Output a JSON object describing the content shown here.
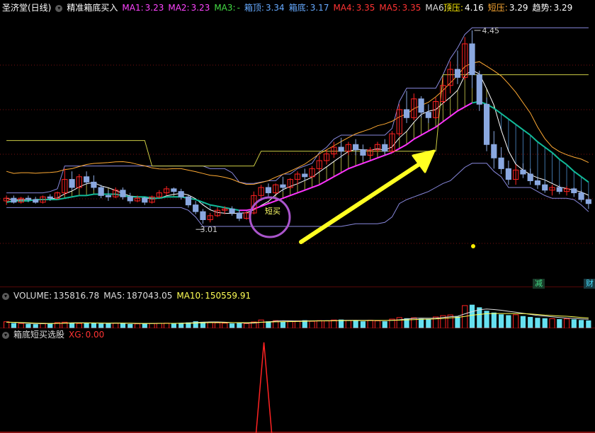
{
  "header": {
    "title": "圣济堂(日线)",
    "indicator_name": "精准箱底买入",
    "items": [
      {
        "label": "MA1:",
        "value": "3.23",
        "color": "#ff44ff"
      },
      {
        "label": "MA2:",
        "value": "3.23",
        "color": "#ff44ff"
      },
      {
        "label": "MA3:",
        "value": "-",
        "color": "#44dd44"
      },
      {
        "label": "箱顶:",
        "value": "3.34",
        "color": "#66aaff"
      },
      {
        "label": "箱底:",
        "value": "3.17",
        "color": "#66aaff"
      },
      {
        "label": "MA4:",
        "value": "3.35",
        "color": "#ff3333"
      },
      {
        "label": "MA5:",
        "value": "3.35",
        "color": "#ff3333"
      },
      {
        "label": "MA6:",
        "value": "-",
        "color": "#dddddd"
      }
    ],
    "right_items": [
      {
        "label": "顶压:",
        "value": "4.16",
        "color": "#ffee00"
      },
      {
        "label": "短压:",
        "value": "3.29",
        "color": "#ffaa33"
      },
      {
        "label": "趋势:",
        "value": "3.29",
        "color": "#ffffff"
      }
    ]
  },
  "annotations": {
    "high_label": "4.45",
    "low_label": "3.01",
    "buy_label": "短买",
    "tag_reduce": "减",
    "tag_wealth": "财"
  },
  "volume_header": {
    "volume": {
      "label": "VOLUME:",
      "value": "135816.78"
    },
    "ma5": {
      "label": "MA5:",
      "value": "187043.05"
    },
    "ma10": {
      "label": "MA10:",
      "value": "150559.91"
    }
  },
  "xg_header": {
    "name": "箱底短买选股",
    "xg": {
      "label": "XG:",
      "value": "0.00"
    }
  },
  "colors": {
    "up": "#ff2222",
    "down": "#8aa8e0",
    "ma_pink": "#ff33ff",
    "ma_teal": "#11bb99",
    "ma_yellow": "#ffff88",
    "box_blue": "#8888dd",
    "orange": "#ffaa33",
    "arrow": "#ffff22",
    "circle": "#aa55cc"
  },
  "chart_data": [
    {
      "type": "candlestick",
      "title": "",
      "ylim": [
        2.6,
        4.55
      ],
      "annotations": {
        "high": 4.45,
        "low": 3.01
      },
      "candles": [
        [
          3.18,
          3.22,
          3.15,
          3.2
        ],
        [
          3.2,
          3.22,
          3.16,
          3.17
        ],
        [
          3.17,
          3.21,
          3.16,
          3.2
        ],
        [
          3.2,
          3.22,
          3.17,
          3.19
        ],
        [
          3.19,
          3.21,
          3.16,
          3.17
        ],
        [
          3.17,
          3.22,
          3.16,
          3.21
        ],
        [
          3.21,
          3.23,
          3.18,
          3.2
        ],
        [
          3.2,
          3.25,
          3.19,
          3.24
        ],
        [
          3.24,
          3.42,
          3.22,
          3.34
        ],
        [
          3.34,
          3.4,
          3.26,
          3.28
        ],
        [
          3.28,
          3.38,
          3.27,
          3.36
        ],
        [
          3.36,
          3.4,
          3.3,
          3.32
        ],
        [
          3.32,
          3.37,
          3.26,
          3.28
        ],
        [
          3.28,
          3.3,
          3.2,
          3.22
        ],
        [
          3.22,
          3.26,
          3.18,
          3.21
        ],
        [
          3.21,
          3.28,
          3.2,
          3.26
        ],
        [
          3.26,
          3.28,
          3.19,
          3.21
        ],
        [
          3.21,
          3.24,
          3.16,
          3.18
        ],
        [
          3.18,
          3.22,
          3.17,
          3.2
        ],
        [
          3.2,
          3.21,
          3.15,
          3.17
        ],
        [
          3.17,
          3.22,
          3.16,
          3.21
        ],
        [
          3.21,
          3.26,
          3.2,
          3.24
        ],
        [
          3.24,
          3.29,
          3.22,
          3.27
        ],
        [
          3.27,
          3.28,
          3.23,
          3.25
        ],
        [
          3.25,
          3.27,
          3.19,
          3.21
        ],
        [
          3.21,
          3.22,
          3.13,
          3.15
        ],
        [
          3.15,
          3.18,
          3.08,
          3.1
        ],
        [
          3.1,
          3.12,
          3.01,
          3.04
        ],
        [
          3.04,
          3.09,
          3.02,
          3.07
        ],
        [
          3.07,
          3.13,
          3.06,
          3.11
        ],
        [
          3.11,
          3.14,
          3.08,
          3.12
        ],
        [
          3.12,
          3.14,
          3.07,
          3.09
        ],
        [
          3.09,
          3.11,
          3.03,
          3.05
        ],
        [
          3.05,
          3.1,
          3.04,
          3.09
        ],
        [
          3.09,
          3.25,
          3.08,
          3.22
        ],
        [
          3.22,
          3.3,
          3.18,
          3.28
        ],
        [
          3.28,
          3.31,
          3.21,
          3.24
        ],
        [
          3.24,
          3.31,
          3.23,
          3.3
        ],
        [
          3.3,
          3.36,
          3.25,
          3.28
        ],
        [
          3.28,
          3.35,
          3.27,
          3.34
        ],
        [
          3.34,
          3.4,
          3.3,
          3.38
        ],
        [
          3.38,
          3.42,
          3.33,
          3.36
        ],
        [
          3.36,
          3.44,
          3.35,
          3.42
        ],
        [
          3.42,
          3.52,
          3.4,
          3.48
        ],
        [
          3.48,
          3.56,
          3.45,
          3.53
        ],
        [
          3.53,
          3.62,
          3.5,
          3.58
        ],
        [
          3.58,
          3.65,
          3.5,
          3.55
        ],
        [
          3.55,
          3.62,
          3.52,
          3.6
        ],
        [
          3.6,
          3.64,
          3.52,
          3.56
        ],
        [
          3.56,
          3.6,
          3.48,
          3.52
        ],
        [
          3.52,
          3.58,
          3.5,
          3.56
        ],
        [
          3.56,
          3.62,
          3.54,
          3.6
        ],
        [
          3.6,
          3.64,
          3.52,
          3.55
        ],
        [
          3.55,
          3.7,
          3.54,
          3.68
        ],
        [
          3.68,
          3.9,
          3.66,
          3.86
        ],
        [
          3.86,
          4.0,
          3.76,
          3.8
        ],
        [
          3.8,
          3.98,
          3.78,
          3.94
        ],
        [
          3.94,
          3.96,
          3.8,
          3.84
        ],
        [
          3.84,
          3.9,
          3.76,
          3.8
        ],
        [
          3.8,
          3.95,
          3.79,
          3.92
        ],
        [
          3.92,
          4.1,
          3.9,
          4.04
        ],
        [
          4.04,
          4.22,
          3.98,
          4.16
        ],
        [
          4.16,
          4.3,
          4.05,
          4.1
        ],
        [
          4.1,
          4.4,
          4.08,
          4.35
        ],
        [
          4.35,
          4.45,
          4.02,
          4.12
        ],
        [
          4.12,
          4.15,
          3.85,
          3.9
        ],
        [
          3.9,
          3.95,
          3.55,
          3.6
        ],
        [
          3.6,
          3.7,
          3.42,
          3.5
        ],
        [
          3.5,
          3.58,
          3.38,
          3.42
        ],
        [
          3.42,
          3.48,
          3.3,
          3.34
        ],
        [
          3.34,
          3.45,
          3.3,
          3.41
        ],
        [
          3.41,
          3.46,
          3.35,
          3.38
        ],
        [
          3.38,
          3.42,
          3.3,
          3.33
        ],
        [
          3.33,
          3.36,
          3.27,
          3.3
        ],
        [
          3.3,
          3.34,
          3.24,
          3.26
        ],
        [
          3.26,
          3.3,
          3.22,
          3.28
        ],
        [
          3.28,
          3.3,
          3.23,
          3.25
        ],
        [
          3.25,
          3.29,
          3.22,
          3.27
        ],
        [
          3.27,
          3.28,
          3.21,
          3.24
        ],
        [
          3.24,
          3.26,
          3.17,
          3.19
        ],
        [
          3.19,
          3.22,
          3.12,
          3.16
        ]
      ],
      "series": [
        {
          "values": [
            3.17,
            3.18,
            3.18,
            3.18,
            3.19,
            3.19,
            3.19,
            3.19,
            3.2,
            3.21,
            3.22,
            3.22,
            3.23,
            3.23,
            3.23,
            3.23,
            3.22,
            3.21,
            3.21,
            3.21,
            3.2,
            3.2,
            3.21,
            3.21,
            3.21,
            3.2,
            3.19,
            3.17,
            3.15,
            3.14,
            3.13,
            3.12,
            3.11,
            3.11,
            3.12,
            3.14,
            3.16,
            3.18,
            3.2,
            3.22,
            3.24,
            3.26,
            3.28,
            3.3,
            3.33,
            3.36,
            3.39,
            3.42,
            3.44,
            3.46,
            3.48,
            3.5,
            3.52,
            3.54,
            3.57,
            3.6,
            3.64,
            3.67,
            3.7,
            3.73,
            3.77,
            3.81,
            3.85,
            3.88,
            3.91,
            3.92,
            3.9,
            3.87,
            3.83,
            3.79,
            3.75,
            3.71,
            3.67,
            3.62,
            3.58,
            3.54,
            3.49,
            3.45,
            3.4,
            3.36,
            3.32
          ]
        },
        {
          "values": [
            3.23,
            3.24,
            3.24,
            3.25,
            3.25,
            3.26,
            3.26,
            3.27,
            3.27,
            3.28,
            3.28,
            3.29,
            3.29,
            3.3,
            3.3,
            3.31,
            3.32,
            3.32,
            3.33,
            3.33,
            3.34,
            3.34,
            3.35,
            3.35,
            3.36,
            3.36,
            3.37,
            3.37,
            3.38,
            3.38,
            3.39,
            3.39,
            3.4,
            3.4,
            3.4,
            3.41,
            3.41,
            3.42,
            3.42,
            3.43,
            3.43,
            3.44,
            3.44,
            3.45,
            3.45,
            3.46,
            3.46,
            3.47,
            3.47,
            3.48,
            3.48,
            3.49,
            3.49,
            3.5,
            3.5,
            3.51,
            3.51,
            3.52,
            3.52,
            3.53,
            3.53,
            3.54,
            3.54,
            3.55,
            3.55,
            3.56,
            3.56,
            3.57,
            3.57,
            3.58,
            3.58,
            3.59,
            3.59,
            3.6,
            3.6,
            3.61,
            3.61,
            3.62,
            3.62,
            3.63,
            3.63
          ]
        }
      ]
    },
    {
      "type": "bar",
      "title": "",
      "values": [
        150,
        120,
        110,
        100,
        95,
        115,
        105,
        130,
        140,
        125,
        110,
        118,
        122,
        108,
        112,
        115,
        120,
        98,
        102,
        108,
        112,
        115,
        118,
        110,
        125,
        135,
        160,
        148,
        138,
        125,
        118,
        112,
        120,
        108,
        145,
        190,
        160,
        175,
        150,
        165,
        170,
        185,
        160,
        175,
        168,
        190,
        200,
        180,
        175,
        160,
        185,
        170,
        160,
        210,
        245,
        230,
        240,
        220,
        215,
        260,
        290,
        305,
        270,
        520,
        540,
        480,
        400,
        360,
        320,
        300,
        310,
        280,
        260,
        240,
        230,
        220,
        210,
        215,
        205,
        190,
        180
      ],
      "ma5": [
        140,
        138,
        125,
        115,
        110,
        106,
        108,
        112,
        118,
        124,
        126,
        124,
        123,
        118,
        115,
        116,
        117,
        112,
        110,
        109,
        108,
        111,
        113,
        114,
        116,
        121,
        130,
        140,
        145,
        146,
        140,
        131,
        124,
        116,
        120,
        137,
        148,
        163,
        175,
        170,
        166,
        170,
        170,
        171,
        173,
        174,
        182,
        183,
        185,
        181,
        182,
        178,
        176,
        181,
        194,
        213,
        226,
        233,
        232,
        233,
        248,
        266,
        276,
        330,
        381,
        424,
        442,
        430,
        413,
        389,
        367,
        344,
        317,
        293,
        279,
        262,
        246,
        234,
        226,
        215,
        206
      ],
      "ma10": [
        140,
        138,
        132,
        125,
        118,
        114,
        112,
        113,
        116,
        120,
        122,
        121,
        121,
        120,
        119,
        120,
        119,
        117,
        114,
        112,
        112,
        113,
        113,
        113,
        114,
        115,
        120,
        126,
        130,
        132,
        130,
        129,
        130,
        128,
        131,
        139,
        143,
        147,
        150,
        153,
        155,
        161,
        165,
        169,
        171,
        172,
        176,
        177,
        178,
        176,
        178,
        180,
        180,
        183,
        187,
        193,
        199,
        206,
        209,
        215,
        225,
        238,
        250,
        272,
        299,
        318,
        334,
        339,
        339,
        338,
        336,
        336,
        327,
        316,
        301,
        292,
        282,
        275,
        262,
        248,
        235
      ]
    },
    {
      "type": "line",
      "title": "",
      "series": [
        {
          "name": "XG",
          "values": [
            0,
            0,
            0,
            0,
            0,
            0,
            0,
            0,
            0,
            0,
            0,
            0,
            0,
            0,
            0,
            0,
            0,
            0,
            0,
            0,
            0,
            0,
            0,
            0,
            0,
            0,
            0,
            0,
            0,
            0,
            0,
            0,
            0,
            0,
            0,
            0,
            0,
            0,
            0,
            0,
            0,
            0,
            0,
            0,
            0,
            0,
            0,
            0,
            0,
            0,
            0,
            0,
            0,
            0,
            0,
            0,
            0,
            0,
            0,
            0,
            0,
            0,
            0,
            0,
            0,
            0,
            0,
            0,
            0,
            0,
            0,
            0,
            0,
            0,
            0,
            0,
            0,
            0,
            0,
            0,
            0
          ]
        }
      ],
      "spike_index": 0,
      "spike_x_fraction": 0.443
    }
  ]
}
